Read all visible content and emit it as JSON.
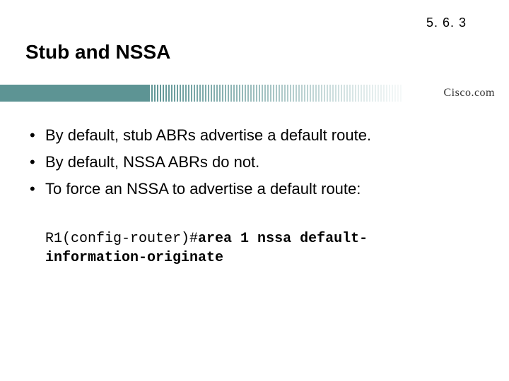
{
  "page_number": "5. 6. 3",
  "title": "Stub and NSSA",
  "brand": "Cisco.com",
  "bullets": [
    "By default, stub ABRs advertise a default route.",
    "By default, NSSA ABRs do not.",
    "To force an NSSA to advertise a default route:"
  ],
  "code": {
    "prompt": "R1(config-router)#",
    "command": "area 1 nssa default-information-originate"
  }
}
